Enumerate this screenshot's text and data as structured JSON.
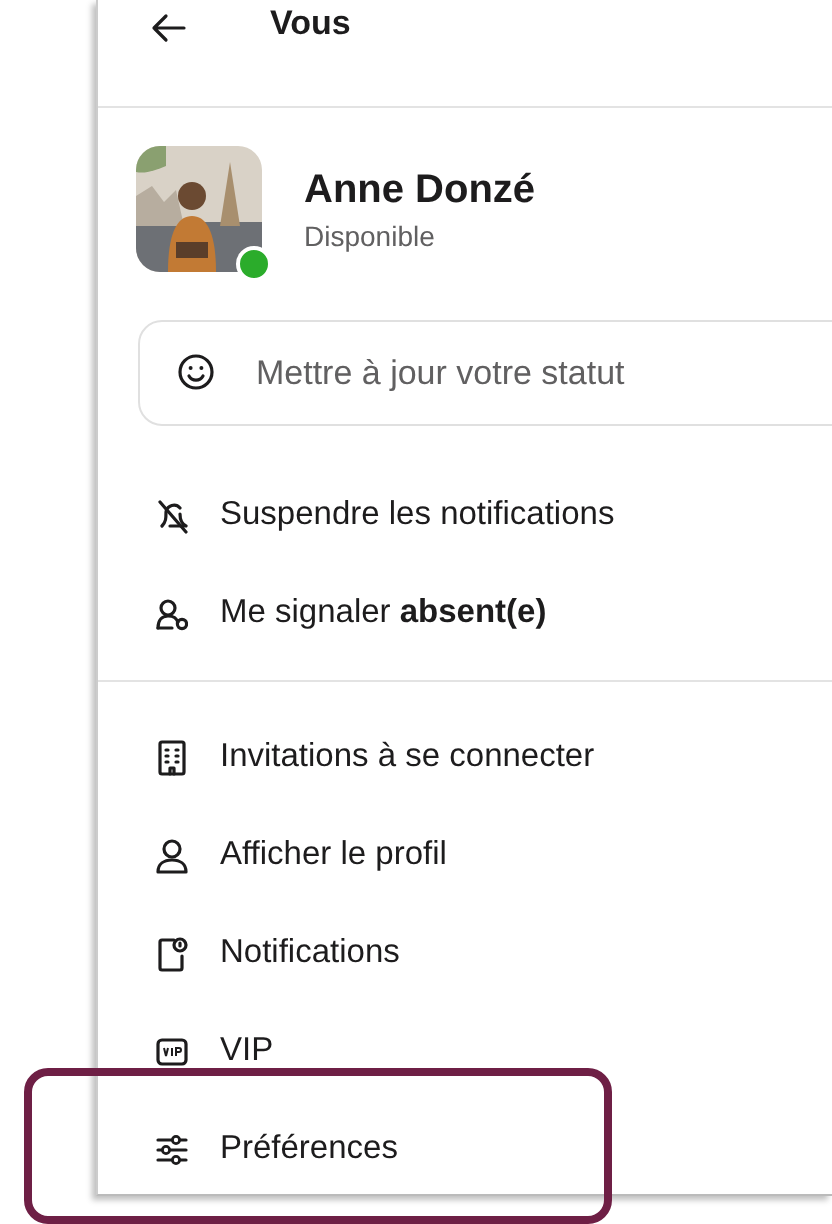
{
  "header": {
    "title": "Vous"
  },
  "profile": {
    "name": "Anne Donzé",
    "status": "Disponible",
    "online": true
  },
  "status_field": {
    "placeholder": "Mettre à jour votre statut"
  },
  "sections": [
    {
      "items": [
        {
          "kind": "bell-off",
          "label": "Suspendre les notifications",
          "highlighted": false
        },
        {
          "kind": "away",
          "label": "Me signaler **absent(e)**",
          "highlighted": false
        }
      ]
    },
    {
      "items": [
        {
          "kind": "building",
          "label": "Invitations à se connecter",
          "highlighted": false
        },
        {
          "kind": "person",
          "label": "Afficher le profil",
          "highlighted": false
        },
        {
          "kind": "phone-bell",
          "label": "Notifications",
          "highlighted": false
        },
        {
          "kind": "vip",
          "label": "VIP",
          "highlighted": false
        },
        {
          "kind": "sliders",
          "label": "Préférences",
          "highlighted": true
        }
      ]
    }
  ]
}
